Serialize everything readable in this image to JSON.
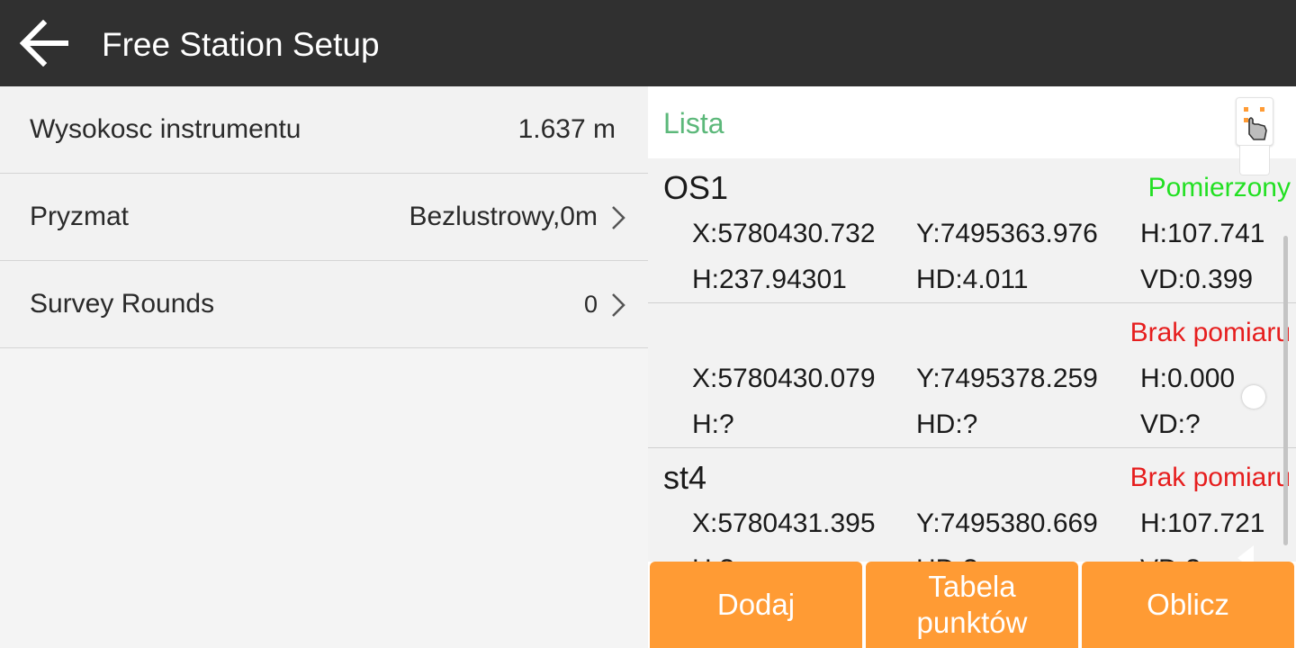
{
  "header": {
    "title": "Free Station Setup",
    "back_icon": "arrow-left-icon"
  },
  "settings": [
    {
      "label": "Wysokosc instrumentu",
      "value": "1.637 m",
      "has_chevron": false
    },
    {
      "label": "Pryzmat",
      "value": "Bezlustrowy,0m",
      "has_chevron": true
    },
    {
      "label": "Survey Rounds",
      "value": "0",
      "has_chevron": true
    }
  ],
  "list": {
    "title": "Lista",
    "points": [
      {
        "name": "OS1",
        "status": "Pomierzony",
        "status_color": "#22e022",
        "x": "X:5780430.732",
        "y": "Y:7495363.976",
        "h": "H:107.741",
        "angle": "H:237.94301",
        "hd": "HD:4.011",
        "vd": "VD:0.399"
      },
      {
        "name": "",
        "status": "Brak pomiaru",
        "status_color": "#e61e1e",
        "x": "X:5780430.079",
        "y": "Y:7495378.259",
        "h": "H:0.000",
        "angle": "H:?",
        "hd": "HD:?",
        "vd": "VD:?"
      },
      {
        "name": "st4",
        "status": "Brak pomiaru",
        "status_color": "#e61e1e",
        "x": "X:5780431.395",
        "y": "Y:7495380.669",
        "h": "H:107.721",
        "angle": "H:?",
        "hd": "HD:?",
        "vd": "VD:?"
      }
    ]
  },
  "buttons": {
    "add": "Dodaj",
    "table": "Tabela punktów",
    "compute": "Oblicz"
  },
  "colors": {
    "header_bg": "#303030",
    "accent_orange": "#ff9b34",
    "list_title_green": "#5cb87a"
  }
}
